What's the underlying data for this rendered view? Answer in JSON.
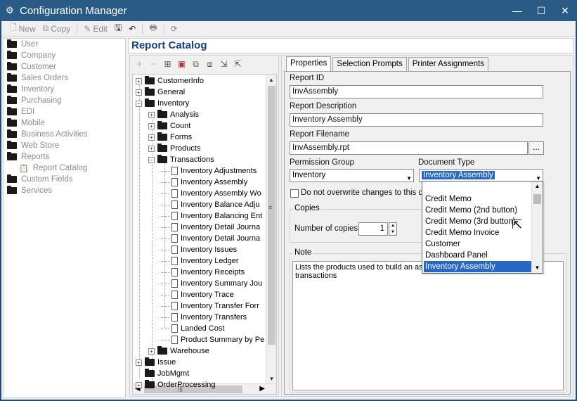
{
  "window": {
    "title": "Configuration Manager",
    "controls": [
      "minimize-icon",
      "maximize-icon",
      "close-icon"
    ]
  },
  "toolbar": {
    "new_label": "New",
    "copy_label": "Copy",
    "edit_label": "Edit"
  },
  "nav": {
    "items": [
      {
        "label": "User"
      },
      {
        "label": "Company"
      },
      {
        "label": "Customer"
      },
      {
        "label": "Sales Orders"
      },
      {
        "label": "Inventory"
      },
      {
        "label": "Purchasing"
      },
      {
        "label": "EDI"
      },
      {
        "label": "Mobile"
      },
      {
        "label": "Business Activities"
      },
      {
        "label": "Web Store"
      },
      {
        "label": "Reports"
      },
      {
        "label": "Report Catalog"
      },
      {
        "label": "Custom Fields"
      },
      {
        "label": "Services"
      }
    ]
  },
  "catalog": {
    "title": "Report Catalog",
    "tree": [
      {
        "label": "CustomerInfo"
      },
      {
        "label": "General"
      },
      {
        "label": "Inventory"
      },
      {
        "label": "Analysis"
      },
      {
        "label": "Count"
      },
      {
        "label": "Forms"
      },
      {
        "label": "Products"
      },
      {
        "label": "Transactions"
      },
      {
        "label": "Inventory Adjustments"
      },
      {
        "label": "Inventory Assembly"
      },
      {
        "label": "Inventory Assembly Wo"
      },
      {
        "label": "Inventory Balance Adju"
      },
      {
        "label": "Inventory Balancing Ent"
      },
      {
        "label": "Inventory Detail Journa"
      },
      {
        "label": "Inventory Detail Journa"
      },
      {
        "label": "Inventory Issues"
      },
      {
        "label": "Inventory Ledger"
      },
      {
        "label": "Inventory Receipts"
      },
      {
        "label": "Inventory Summary Jou"
      },
      {
        "label": "Inventory Trace"
      },
      {
        "label": "Inventory Transfer Forr"
      },
      {
        "label": "Inventory Transfers"
      },
      {
        "label": "Landed Cost"
      },
      {
        "label": "Product Summary by Pe"
      },
      {
        "label": "Warehouse"
      },
      {
        "label": "Issue"
      },
      {
        "label": "JobMgmt"
      },
      {
        "label": "OrderProcessing"
      }
    ]
  },
  "tabs": [
    {
      "label": "Properties"
    },
    {
      "label": "Selection Prompts"
    },
    {
      "label": "Printer Assignments"
    }
  ],
  "form": {
    "report_id_label": "Report ID",
    "report_id_value": "InvAssembly",
    "report_desc_label": "Report Description",
    "report_desc_value": "Inventory Assembly",
    "report_file_label": "Report Filename",
    "report_file_value": "InvAssembly.rpt",
    "browse_label": "...",
    "perm_group_label": "Permission Group",
    "perm_group_value": "Inventory",
    "doc_type_label": "Document Type",
    "doc_type_value": "Inventory Assembly",
    "overwrite_label": "Do not overwrite changes to this de",
    "copies_title": "Copies",
    "num_copies_label": "Number of copies:",
    "num_copies_value": "1",
    "note_title": "Note",
    "note_text": "Lists the products used to build an ass\ntransactions"
  },
  "dropdown": {
    "options": [
      {
        "label": "Credit Memo"
      },
      {
        "label": "Credit Memo (2nd button)"
      },
      {
        "label": "Credit Memo (3rd button)"
      },
      {
        "label": "Credit Memo Invoice"
      },
      {
        "label": "Customer"
      },
      {
        "label": "Dashboard Panel"
      },
      {
        "label": "Inventory Assembly"
      }
    ],
    "selected": "Inventory Assembly"
  },
  "colors": {
    "accent": "#2668c5",
    "title_blue": "#1a3e8a",
    "titlebar": "#2a5a86"
  }
}
